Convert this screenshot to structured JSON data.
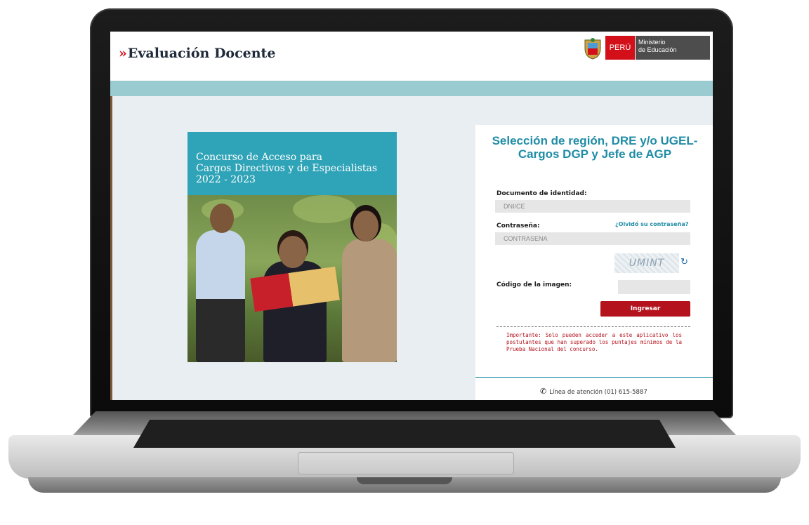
{
  "header": {
    "brand_chevrons": "»",
    "brand_title": "Evaluación Docente",
    "logo_country": "PERÚ",
    "logo_ministry_line1": "Ministerio",
    "logo_ministry_line2": "de Educación"
  },
  "poster": {
    "title_line1": "Concurso de Acceso para",
    "title_line2": "Cargos Directivos y de Especialistas",
    "title_line3": "2022 - 2023"
  },
  "login": {
    "title": "Selección de región, DRE y/o UGEL- Cargos DGP y Jefe de AGP",
    "doc_label": "Documento de identidad:",
    "doc_placeholder": "DNI/CE",
    "password_label": "Contraseña:",
    "password_placeholder": "CONTRASENA",
    "forgot_link": "¿Olvidó su contraseña?",
    "captcha_text": "UMINT",
    "captcha_label": "Código de la imagen:",
    "submit_label": "Ingresar",
    "notice": "Importante: Solo pueden acceder a este aplicativo los postulantes que han superado los puntajes mínimos de la Prueba Nacional del concurso."
  },
  "footer": {
    "helpline": "Línea de atención (01) 615-5887"
  },
  "colors": {
    "accent": "#1f8ca6",
    "brand_red": "#b4121c",
    "band": "#99cbd0"
  },
  "icons": {
    "refresh": "refresh-icon",
    "phone": "phone-icon",
    "shield": "peru-shield-icon"
  }
}
